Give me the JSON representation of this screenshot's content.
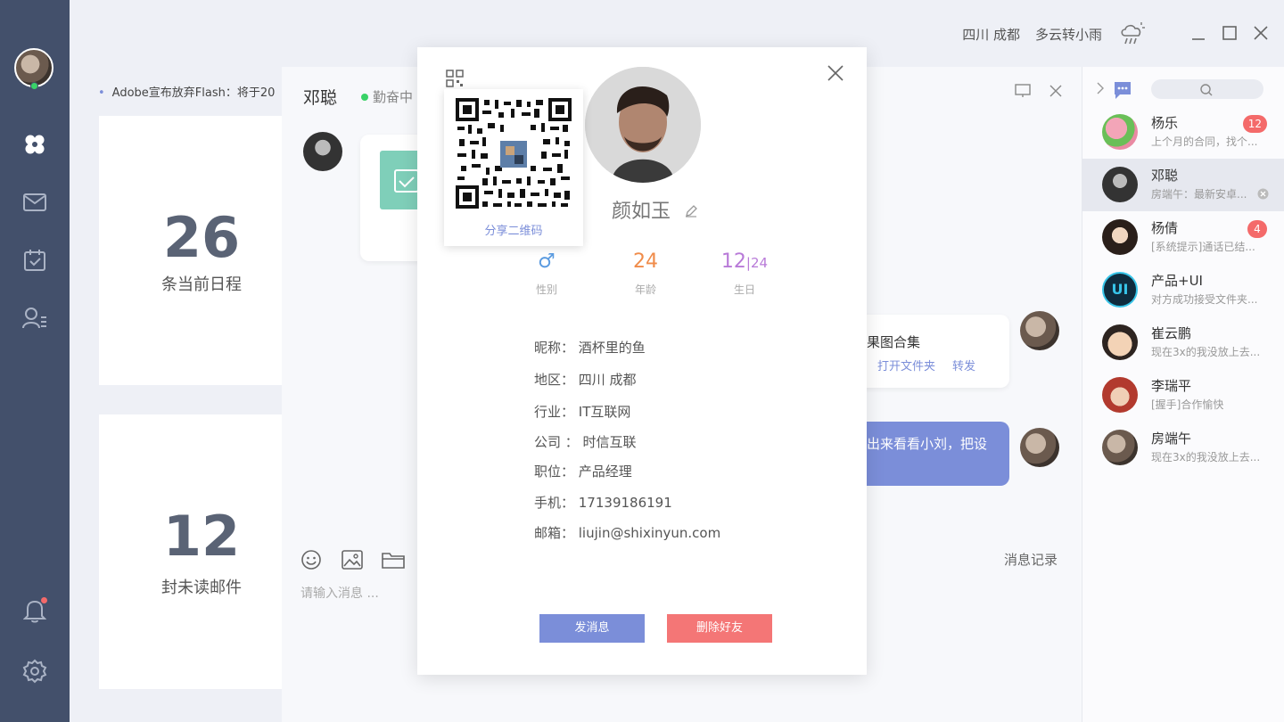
{
  "window": {
    "location": "四川 成都",
    "weather": "多云转小雨",
    "weather_icon": "cloud-rain-icon"
  },
  "nav": {
    "items": [
      "dashboard",
      "mail",
      "calendar",
      "contacts",
      "notifications",
      "settings"
    ]
  },
  "ticker": {
    "text": "Adobe宣布放弃Flash：将于20"
  },
  "stats": [
    {
      "value": "26",
      "label": "条当前日程"
    },
    {
      "value": "12",
      "label": "封未读邮件"
    }
  ],
  "chat": {
    "title": "邓聪",
    "status": "勤奋中",
    "file_title_partial": "果图合集",
    "file_actions": [
      "打开文件夹",
      "转发"
    ],
    "outgoing_partial": "出来看看小刘，把设",
    "input_placeholder": "请输入消息 ...",
    "history_link": "消息记录"
  },
  "contacts": [
    {
      "name": "杨乐",
      "message": "上个月的合同，找个...",
      "badge": "12",
      "color": "#e98aa3"
    },
    {
      "name": "邓聪",
      "message": "房端午：最新安卓...",
      "badge": "",
      "color": "#4a4a4a",
      "active": true
    },
    {
      "name": "杨倩",
      "message": "[系统提示]通话已结...",
      "badge": "4",
      "color": "#3a2a22"
    },
    {
      "name": "产品+UI",
      "message": "对方成功接受文件夹...",
      "badge": "",
      "color": "#0f2b3d"
    },
    {
      "name": "崔云鹏",
      "message": "现在3x的我没放上去...",
      "badge": "",
      "color": "#f0c9a8"
    },
    {
      "name": "李瑞平",
      "message": "[握手]合作愉快",
      "badge": "",
      "color": "#b23a2e"
    },
    {
      "name": "房端午",
      "message": "现在3x的我没放上去...",
      "badge": "",
      "color": "#6a5246"
    }
  ],
  "profile": {
    "name": "颜如玉",
    "qr_label": "分享二维码",
    "gender_label": "性别",
    "gender_symbol": "♂",
    "age": "24",
    "age_label": "年龄",
    "birthday_month": "12",
    "birthday_day": "24",
    "birthday_label": "生日",
    "info": [
      "昵称： 酒杯里的鱼",
      "地区： 四川  成都",
      "行业： IT互联网",
      "公司 ： 时信互联",
      "职位： 产品经理",
      "手机： 17139186191",
      "邮箱： liujin@shixinyun.com"
    ],
    "send_button": "发消息",
    "delete_button": "删除好友"
  },
  "colors": {
    "nav_bg": "#43506b",
    "accent": "#7b8ed9",
    "danger": "#f47676",
    "gender": "#5b9be0",
    "age": "#f08c4a",
    "birthday": "#b87ad8",
    "online": "#39d267"
  }
}
